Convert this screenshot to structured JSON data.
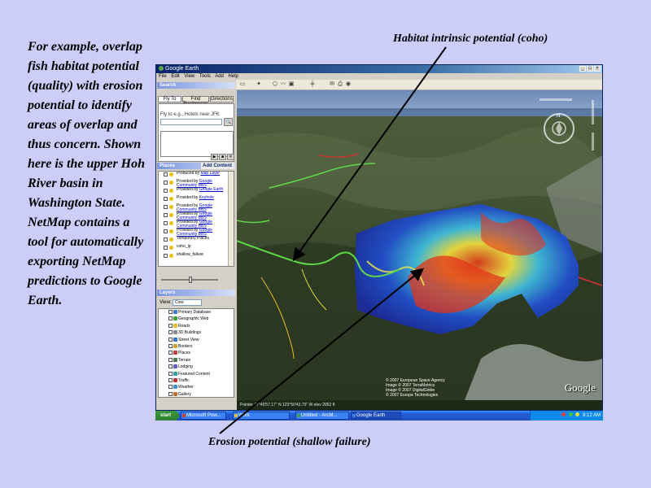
{
  "caption": "For example, overlap fish habitat potential (quality) with erosion potential to identify areas of overlap and thus concern. Shown here is the upper Hoh River basin in Washington State. NetMap contains a tool for automatically exporting NetMap predictions to Google Earth.",
  "callout_top": "Habitat intrinsic potential (coho)",
  "callout_bottom": "Erosion potential (shallow failure)",
  "window": {
    "title": "Google Earth",
    "menu": [
      "File",
      "Edit",
      "View",
      "Tools",
      "Add",
      "Help"
    ]
  },
  "search": {
    "header": "Search",
    "tabs": [
      "Fly To",
      "Find Businesses",
      "Directions"
    ],
    "hint": "Fly to e.g., Hotels near JFK",
    "controls": [
      "▶",
      "■",
      "✕"
    ]
  },
  "places": {
    "header": "Places",
    "add_content": "Add Content",
    "items": [
      {
        "text": "Produced by",
        "link": "Map Layer"
      },
      {
        "text": "Provided by",
        "link": "Google Community BBS"
      },
      {
        "text": "Provided by",
        "link": "Google Earth"
      },
      {
        "text": "Provided by",
        "link": "Keyhole"
      },
      {
        "text": "Provided by",
        "link": "Google Community BBS"
      },
      {
        "text": "Provided by",
        "link": "Google Community BBS"
      },
      {
        "text": "Provided by",
        "link": "Google Community BBS"
      },
      {
        "text": "Provided by",
        "link": "Google Community BBS"
      },
      {
        "text": "Temporary Places",
        "link": ""
      },
      {
        "text": "coho_ip",
        "link": ""
      },
      {
        "text": "shallow_failure",
        "link": ""
      }
    ]
  },
  "layers": {
    "header": "Layers",
    "view_label": "View:",
    "view_value": "Core",
    "items": [
      {
        "name": "Primary Database",
        "color": "#4a78c8"
      },
      {
        "name": "Geographic Web",
        "color": "#3aa040"
      },
      {
        "name": "Roads",
        "color": "#e0c030"
      },
      {
        "name": "3D Buildings",
        "color": "#8a8a8a"
      },
      {
        "name": "Street View",
        "color": "#3070d0"
      },
      {
        "name": "Borders",
        "color": "#d0a030"
      },
      {
        "name": "Places",
        "color": "#c04040"
      },
      {
        "name": "Terrain",
        "color": "#507850"
      },
      {
        "name": "Lodging",
        "color": "#6060c0"
      },
      {
        "name": "Featured Content",
        "color": "#30a0a0"
      },
      {
        "name": "Traffic",
        "color": "#c03030"
      },
      {
        "name": "Weather",
        "color": "#4090d0"
      },
      {
        "name": "Gallery",
        "color": "#c07030"
      }
    ]
  },
  "map": {
    "copyright": "© 2007 European Space Agency\nImage © 2007 TerraMetrics\nImage © 2007 DigitalGlobe\n© 2007 Europa Technologies",
    "logo": "Google",
    "status": "Pointer 47°45'57.17\" N  123°50'43.75\" W  elev 2852 ft"
  },
  "taskbar": {
    "start": "start",
    "tasks": [
      {
        "label": "Microsoft Pow...",
        "color": "#d04020",
        "active": false
      },
      {
        "label": "Work",
        "color": "#e8c040",
        "active": false
      },
      {
        "label": "Untitled - ArcM...",
        "color": "#40a040",
        "active": false
      },
      {
        "label": "Google Earth",
        "color": "#4080e0",
        "active": true
      }
    ],
    "clock": "9:12 AM"
  }
}
